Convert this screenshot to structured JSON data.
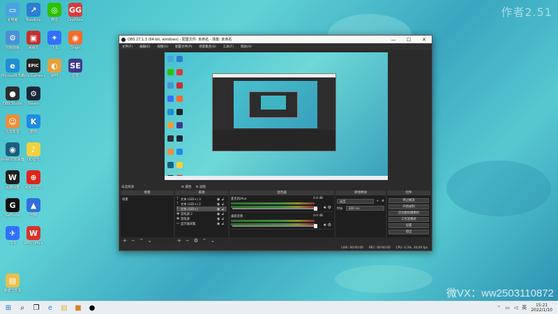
{
  "wallpaper": {
    "watermark_top": "作者2.51",
    "watermark_bottom": "微VX：ww2503110872"
  },
  "desktop_icons": [
    {
      "label": "此电脑",
      "color": "#4aa3df",
      "glyph": "▭"
    },
    {
      "label": "Bandizip",
      "color": "#2d7dd2",
      "glyph": "↗"
    },
    {
      "label": "微信",
      "color": "#2dc100",
      "glyph": "◎"
    },
    {
      "label": "OneNote",
      "color": "#d83b3b",
      "glyph": "GG"
    },
    {
      "label": "控制面板",
      "color": "#4a90d9",
      "glyph": "⚙"
    },
    {
      "label": "网易云",
      "color": "#c62f2f",
      "glyph": "▣"
    },
    {
      "label": "飞书",
      "color": "#3370ff",
      "glyph": "✦"
    },
    {
      "label": "Origin",
      "color": "#f56c2d",
      "glyph": "◉"
    },
    {
      "label": "Microsoft Edge",
      "color": "#1f8fd1",
      "glyph": "e"
    },
    {
      "label": "Epic Games Launcher",
      "color": "#222222",
      "glyph": "EPIC"
    },
    {
      "label": "WPS",
      "color": "#e4a13c",
      "glyph": "◐"
    },
    {
      "label": "迅雷",
      "color": "#3b3b8f",
      "glyph": "SE"
    },
    {
      "label": "OBS Studio",
      "color": "#2c2c2c",
      "glyph": "●"
    },
    {
      "label": "Steam",
      "color": "#1b2838",
      "glyph": "⚙"
    },
    {
      "label": "迅雷影音",
      "color": "#e8903b",
      "glyph": "☺"
    },
    {
      "label": "酷狗",
      "color": "#1e8be6",
      "glyph": "K"
    },
    {
      "label": "网易UU加速器",
      "color": "#1b5e80",
      "glyph": "◉"
    },
    {
      "label": "QQ音乐",
      "color": "#f3d03e",
      "glyph": "♪"
    },
    {
      "label": "百度网盘",
      "color": "#1f1f1f",
      "glyph": "W"
    },
    {
      "label": "网易云音乐",
      "color": "#e2231a",
      "glyph": "⊕"
    },
    {
      "label": "GeForce",
      "color": "#111111",
      "glyph": "G"
    },
    {
      "label": "剪映",
      "color": "#2f6fde",
      "glyph": "▲"
    },
    {
      "label": "飞书",
      "color": "#3370ff",
      "glyph": "✈"
    },
    {
      "label": "WPS Office",
      "color": "#d9332a",
      "glyph": "W"
    },
    {
      "label": "新建文件夹",
      "color": "#e8c04a",
      "glyph": "▤"
    }
  ],
  "obs": {
    "title": "OBS 27.1.3 (64-bit, windows) - 配置文件: 未命名 - 场景: 未命名",
    "menu": [
      "文件(F)",
      "编辑(E)",
      "视图(V)",
      "配置文件(P)",
      "场景集合(S)",
      "工具(T)",
      "帮助(H)"
    ],
    "dock_tabs": [
      "未选择源",
      "属性",
      "滤镜"
    ],
    "scenes": {
      "header": "场景",
      "items": [
        "场景"
      ]
    },
    "sources": {
      "header": "来源",
      "items": [
        {
          "name": "文本 (GDI+) 3",
          "icon": "T"
        },
        {
          "name": "文本 (GDI+) 2",
          "icon": "T"
        },
        {
          "name": "文本 (GDI+)",
          "icon": "T"
        },
        {
          "name": "游戏源 2",
          "icon": "▣"
        },
        {
          "name": "游戏源",
          "icon": "▣"
        },
        {
          "name": "显示器采集",
          "icon": "▭"
        }
      ]
    },
    "mixer": {
      "header": "混音器",
      "channels": [
        {
          "name": "麦克风/Aux",
          "db": "0.0 dB"
        },
        {
          "name": "桌面音频",
          "db": "0.0 dB"
        }
      ]
    },
    "transitions": {
      "header": "转场特效",
      "type": "淡出",
      "duration_label": "时长",
      "duration": "300 ms"
    },
    "controls": {
      "header": "控件",
      "buttons": [
        "停止推流",
        "开始录制",
        "启动虚拟摄像机",
        "工作室模式",
        "设置",
        "退出"
      ]
    },
    "status": {
      "live": "LIVE: 00:00:00",
      "rec": "REC: 00:00:00",
      "cpu": "CPU: 0.3%, 30.00 fps"
    }
  },
  "taskbar": {
    "time": "15:21",
    "date": "2022/1/10"
  }
}
